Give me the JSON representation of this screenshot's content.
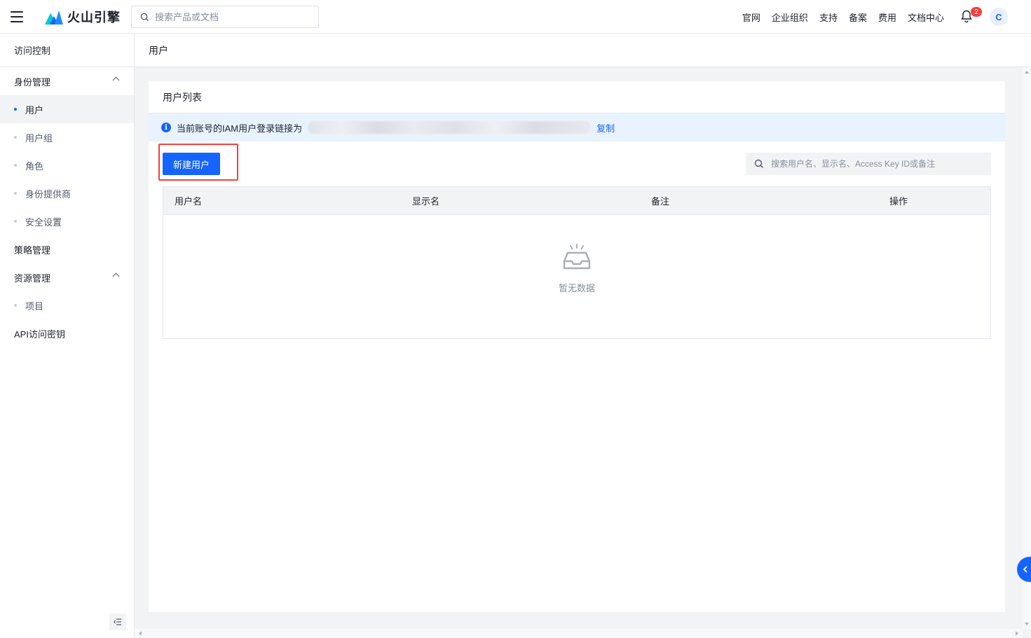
{
  "topbar": {
    "logo_text": "火山引擎",
    "search_placeholder": "搜索产品或文档",
    "nav": [
      "官网",
      "企业组织",
      "支持",
      "备案",
      "费用",
      "文档中心"
    ],
    "notification_count": "2",
    "avatar_letter": "C"
  },
  "sidebar": {
    "title": "访问控制",
    "group_identity": "身份管理",
    "identity_items": [
      "用户",
      "用户组",
      "角色",
      "身份提供商",
      "安全设置"
    ],
    "policy": "策略管理",
    "group_resource": "资源管理",
    "resource_items": [
      "项目"
    ],
    "api_keys": "API访问密钥"
  },
  "breadcrumb": "用户",
  "panel": {
    "title": "用户列表",
    "info_text": "当前账号的IAM用户登录链接为",
    "copy_label": "复制",
    "create_button": "新建用户",
    "search_placeholder": "搜索用户名、显示名、Access Key ID或备注",
    "columns": [
      "用户名",
      "显示名",
      "备注",
      "操作"
    ],
    "empty_text": "暂无数据"
  },
  "colors": {
    "primary": "#1664ff",
    "highlight": "#f53f3f",
    "info_bg": "#e8f3ff"
  }
}
